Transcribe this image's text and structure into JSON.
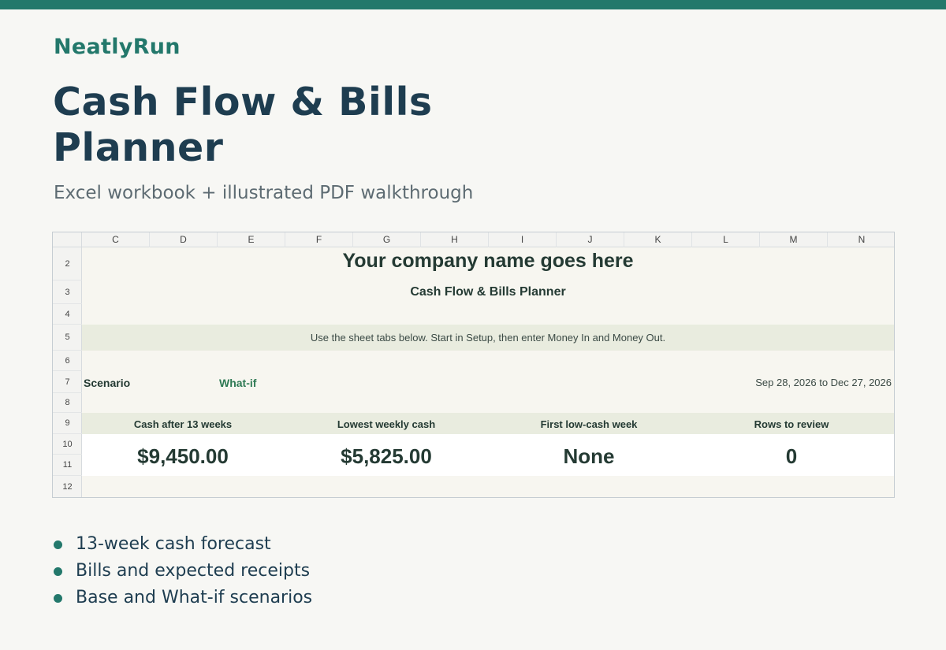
{
  "colors": {
    "accent": "#23786b",
    "title": "#1e3d50",
    "band": "#e9ecdf"
  },
  "brand": "NeatlyRun",
  "title": "Cash Flow & Bills Planner",
  "subtitle": "Excel workbook + illustrated PDF walkthrough",
  "sheet": {
    "columns": [
      "C",
      "D",
      "E",
      "F",
      "G",
      "H",
      "I",
      "J",
      "K",
      "L",
      "M",
      "N"
    ],
    "rows": [
      "2",
      "3",
      "4",
      "5",
      "6",
      "7",
      "8",
      "9",
      "10",
      "11",
      "12"
    ],
    "company": "Your company name goes here",
    "sheet_title": "Cash Flow & Bills Planner",
    "instructions": "Use the sheet tabs below. Start in Setup, then enter Money In and Money Out.",
    "scenario_label": "Scenario",
    "scenario_value": "What-if",
    "date_range": "Sep 28, 2026 to Dec 27, 2026",
    "kpis": [
      {
        "label": "Cash after 13 weeks",
        "value": "$9,450.00"
      },
      {
        "label": "Lowest weekly cash",
        "value": "$5,825.00"
      },
      {
        "label": "First low-cash week",
        "value": "None"
      },
      {
        "label": "Rows to review",
        "value": "0"
      }
    ]
  },
  "features": [
    "13-week cash forecast",
    "Bills and expected receipts",
    "Base and What-if scenarios"
  ]
}
